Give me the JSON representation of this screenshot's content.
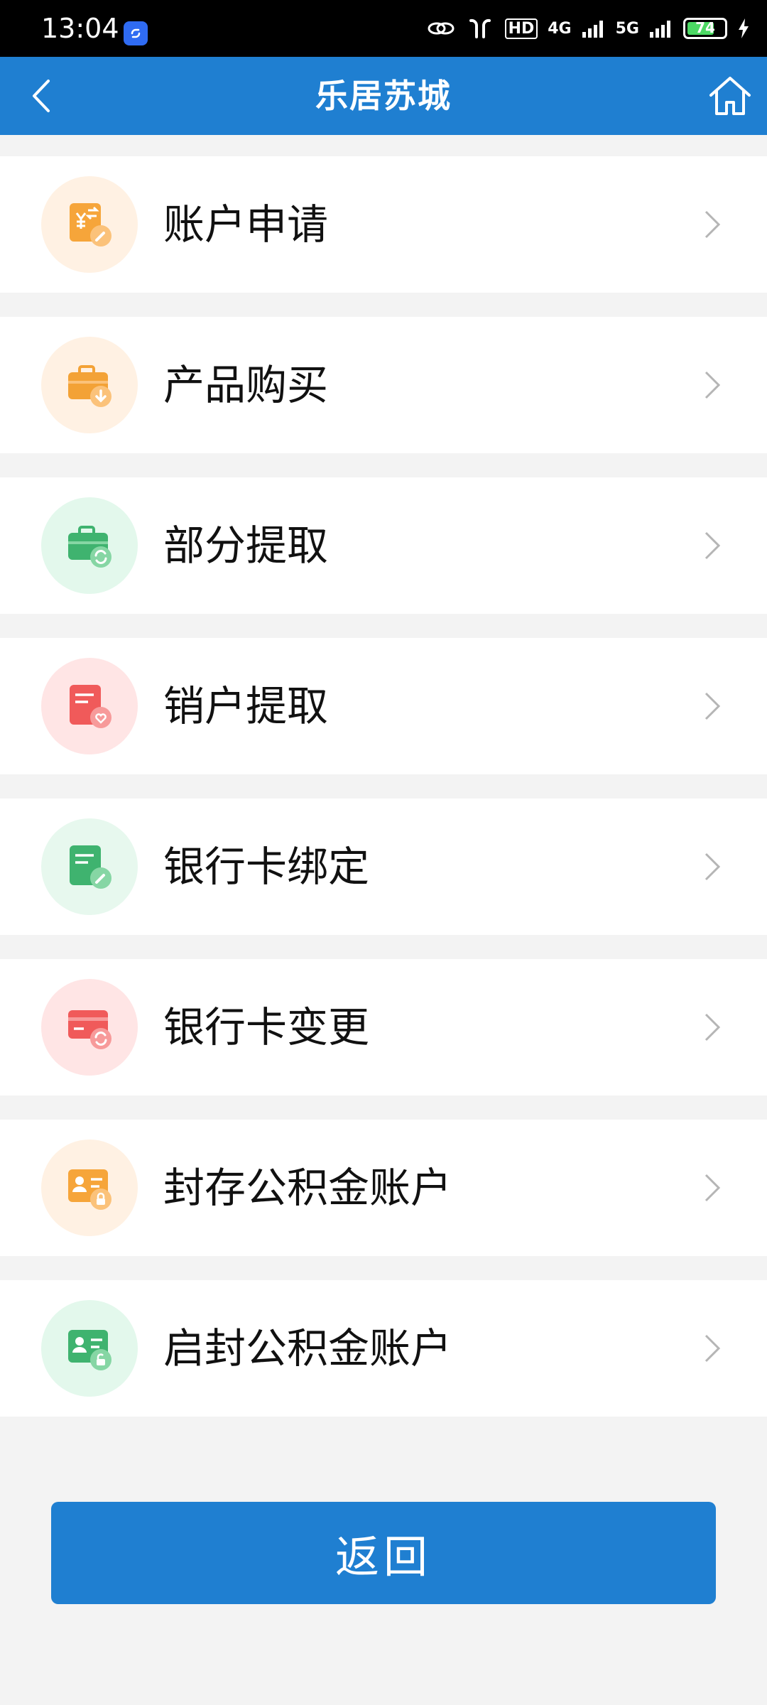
{
  "status_bar": {
    "time": "13:04",
    "network_hd": "HD",
    "network_4g": "4G",
    "network_5g": "5G",
    "battery": "74",
    "battery_level": 0.74
  },
  "header": {
    "title": "乐居苏城",
    "back_icon": "chevron-left-icon",
    "home_icon": "home-icon"
  },
  "menu": {
    "items": [
      {
        "label": "账户申请",
        "icon": "account-apply-icon",
        "color": "#f6a53a",
        "bg": "#fff1e3"
      },
      {
        "label": "产品购买",
        "icon": "product-purchase-icon",
        "color": "#f3a236",
        "bg": "#fff1e3"
      },
      {
        "label": "部分提取",
        "icon": "partial-withdraw-icon",
        "color": "#3fb36f",
        "bg": "#e3f8ec"
      },
      {
        "label": "销户提取",
        "icon": "close-account-withdraw-icon",
        "color": "#f05a5a",
        "bg": "#ffe5e5"
      },
      {
        "label": "银行卡绑定",
        "icon": "bank-card-bind-icon",
        "color": "#3fb36f",
        "bg": "#e7f8ee"
      },
      {
        "label": "银行卡变更",
        "icon": "bank-card-change-icon",
        "color": "#f05a5a",
        "bg": "#ffe5e5"
      },
      {
        "label": "封存公积金账户",
        "icon": "seal-fund-account-icon",
        "color": "#f6a53a",
        "bg": "#fff1e3"
      },
      {
        "label": "启封公积金账户",
        "icon": "unseal-fund-account-icon",
        "color": "#3fb36f",
        "bg": "#e3f8ec"
      }
    ]
  },
  "footer": {
    "back_label": "返回"
  },
  "colors": {
    "primary": "#1f7fd1",
    "background": "#f3f3f3"
  }
}
